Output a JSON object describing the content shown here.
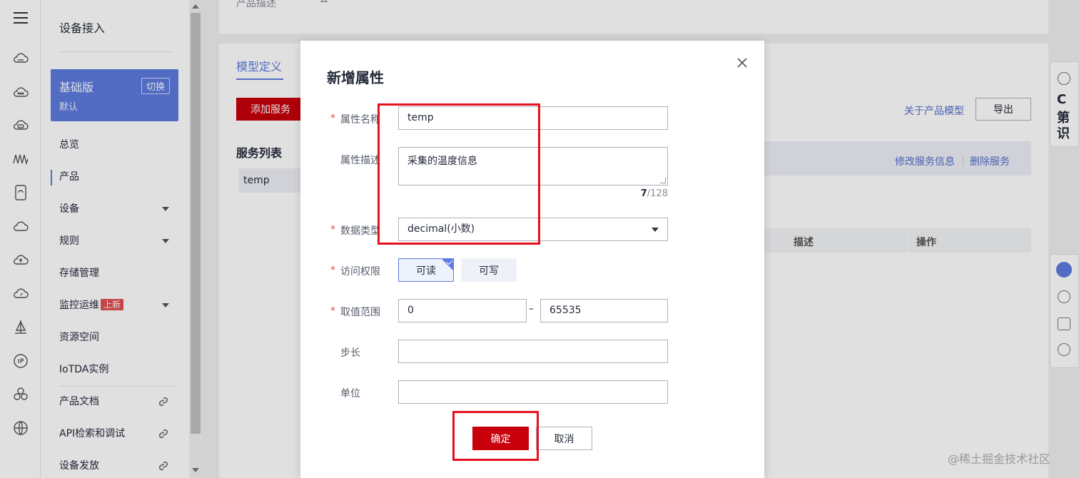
{
  "rail": {
    "icons": [
      "menu-icon",
      "cloud-icon",
      "cloud-dots-icon",
      "cloud-link-icon",
      "waveform-icon",
      "device-icon",
      "cloud-outline-icon",
      "cloud-upload-icon",
      "cloud-gauge-icon",
      "sail-icon",
      "ip-icon",
      "cluster-icon",
      "globe-icon"
    ]
  },
  "sidenav": {
    "title": "设备接入",
    "edition": {
      "name": "基础版",
      "sub": "默认",
      "switch": "切换"
    },
    "items": [
      {
        "label": "总览"
      },
      {
        "label": "产品"
      },
      {
        "label": "设备"
      },
      {
        "label": "规则"
      },
      {
        "label": "存储管理"
      },
      {
        "label": "监控运维",
        "badge": "上新"
      },
      {
        "label": "资源空间"
      },
      {
        "label": "IoTDA实例"
      },
      {
        "label": "产品文档"
      },
      {
        "label": "API检索和调试"
      },
      {
        "label": "设备发放"
      }
    ]
  },
  "background": {
    "product_desc_label": "产品描述",
    "product_desc_value": "--",
    "tab_model": "模型定义",
    "add_service": "添加服务",
    "about_model": "关于产品模型",
    "export": "导出",
    "service_list_title": "服务列表",
    "service_item": "temp",
    "edit_service": "修改服务信息",
    "delete_service": "删除服务",
    "col_desc": "描述",
    "col_op": "操作"
  },
  "modal": {
    "title": "新增属性",
    "name_label": "属性名称",
    "name_value": "temp",
    "desc_label": "属性描述",
    "desc_value": "采集的温度信息",
    "desc_count": "7",
    "desc_max": "/128",
    "type_label": "数据类型",
    "type_value": "decimal(小数)",
    "perm_label": "访问权限",
    "perm_read": "可读",
    "perm_write": "可写",
    "range_label": "取值范围",
    "range_min": "0",
    "range_dash": "–",
    "range_max": "65535",
    "step_label": "步长",
    "unit_label": "单位",
    "ok": "确定",
    "cancel": "取消",
    "required_mark": "*"
  },
  "colors": {
    "accent": "#5e7ce0",
    "primary_red": "#c7000b",
    "annotation_red": "#e5111c"
  },
  "watermark": "@稀土掘金技术社区",
  "right_float": {
    "text1": "C",
    "text2": "第",
    "text3": "识"
  }
}
